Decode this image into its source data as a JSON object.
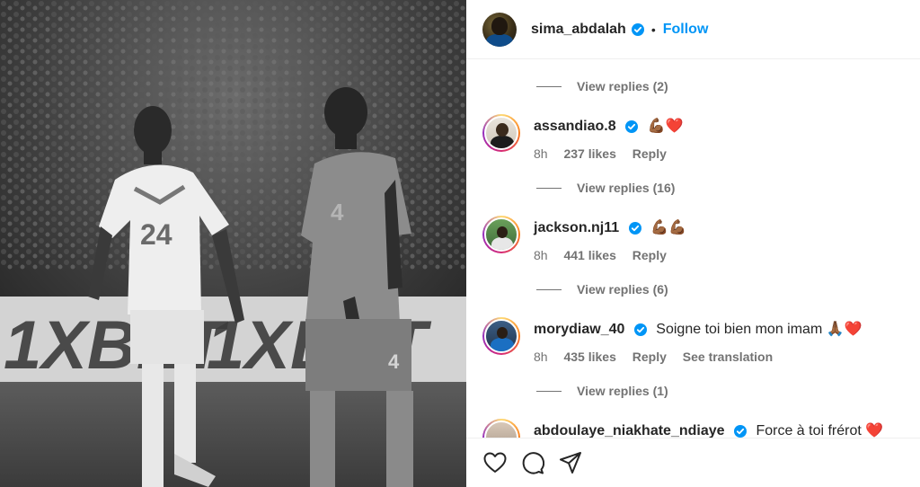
{
  "post": {
    "image_alt_icon": "photo",
    "author": {
      "username": "sima_abdalah",
      "verified": true,
      "separator": "•",
      "follow_label": "Follow"
    }
  },
  "colors": {
    "accent": "#0095f6",
    "verified": "#0095f6",
    "muted": "#737373",
    "text": "#262626"
  },
  "replies_toggles": [
    {
      "label": "View replies (2)"
    },
    {
      "label": "View replies (16)"
    },
    {
      "label": "View replies (6)"
    },
    {
      "label": "View replies (1)"
    }
  ],
  "comments": [
    {
      "username": "assandiao.8",
      "verified": true,
      "text": "💪🏾❤️",
      "time": "8h",
      "likes": "237 likes",
      "reply_label": "Reply"
    },
    {
      "username": "jackson.nj11",
      "verified": true,
      "text": "💪🏾💪🏾",
      "time": "8h",
      "likes": "441 likes",
      "reply_label": "Reply"
    },
    {
      "username": "morydiaw_40",
      "verified": true,
      "text": "Soigne toi bien mon imam 🙏🏾❤️",
      "time": "8h",
      "likes": "435 likes",
      "reply_label": "Reply",
      "translation_label": "See translation"
    },
    {
      "username": "abdoulaye_niakhate_ndiaye",
      "verified": true,
      "text": "Force à toi frérot ❤️"
    }
  ],
  "actions": {
    "like_icon": "heart-icon",
    "comment_icon": "comment-icon",
    "share_icon": "share-icon"
  }
}
